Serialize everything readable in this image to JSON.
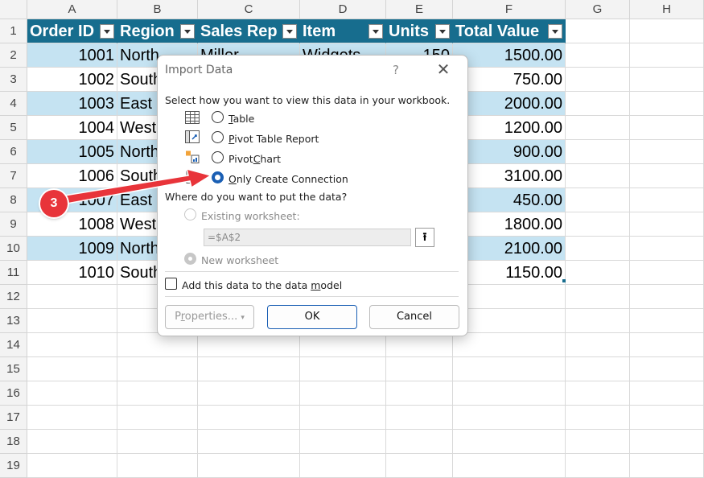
{
  "columns": [
    "A",
    "B",
    "C",
    "D",
    "E",
    "F",
    "G",
    "H"
  ],
  "rows": [
    "1",
    "2",
    "3",
    "4",
    "5",
    "6",
    "7",
    "8",
    "9",
    "10",
    "11",
    "12",
    "13",
    "14",
    "15",
    "16",
    "17",
    "18",
    "19"
  ],
  "table": {
    "headers": [
      "Order ID",
      "Region",
      "Sales Rep",
      "Item",
      "Units",
      "Total Value"
    ],
    "order_ids": [
      "1001",
      "1002",
      "1003",
      "1004",
      "1005",
      "1006",
      "1007",
      "1008",
      "1009",
      "1010"
    ],
    "regions": [
      "North",
      "South",
      "East",
      "West",
      "North",
      "South",
      "East",
      "West",
      "North",
      "South"
    ],
    "rep_row2": "Miller",
    "item_row2": "Widgets",
    "units_row2": "150",
    "totals": [
      "1500.00",
      "750.00",
      "2000.00",
      "1200.00",
      "900.00",
      "3100.00",
      "450.00",
      "1800.00",
      "2100.00",
      "1150.00"
    ]
  },
  "dialog": {
    "title": "Import Data",
    "help": "?",
    "close": "✕",
    "view_prompt": "Select how you want to view this data in your workbook.",
    "options": [
      {
        "pre": "",
        "u": "T",
        "post": "able"
      },
      {
        "pre": "",
        "u": "P",
        "post": "ivot Table Report"
      },
      {
        "pre": "Pivot",
        "u": "C",
        "post": "hart"
      },
      {
        "pre": "",
        "u": "O",
        "post": "nly Create Connection"
      }
    ],
    "selected_option": "Only Create Connection",
    "put_prompt": "Where do you want to put the data?",
    "existing_worksheet": "Existing worksheet:",
    "range_value": "=$A$2",
    "range_button": "⭱",
    "new_worksheet": "New worksheet",
    "data_model": {
      "pre": "Add this data to the data ",
      "u": "m",
      "post": "odel"
    },
    "properties": {
      "pre": "P",
      "u": "r",
      "post": "operties..."
    },
    "properties_caret": "▾",
    "ok": "OK",
    "cancel": "Cancel"
  },
  "annotation": {
    "number": "3",
    "color": "#e8343a"
  },
  "colors": {
    "table_header": "#176d8e",
    "band": "#c5e3f2",
    "accent": "#1a5fb4"
  }
}
